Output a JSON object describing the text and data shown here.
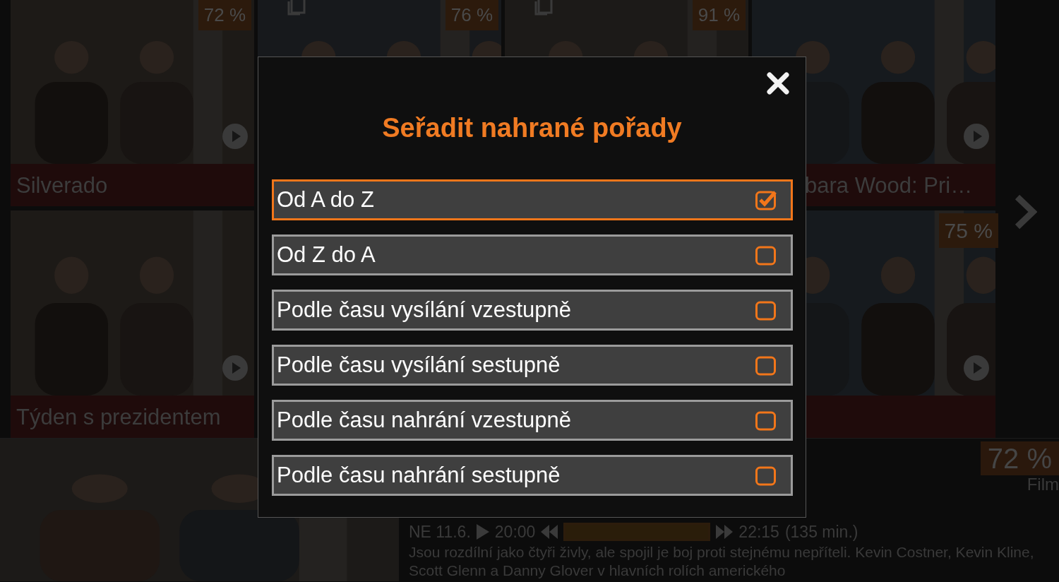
{
  "tiles": [
    {
      "kind": "tile",
      "badge": "72 %",
      "title": "Silverado"
    },
    {
      "kind": "partial",
      "badge": "76 %",
      "multi": true
    },
    {
      "kind": "partial",
      "badge": "91 %",
      "multi": true
    },
    {
      "kind": "tile",
      "title": "bara Wood: Pri…"
    },
    {
      "kind": "tile",
      "title": "Týden s prezidentem"
    },
    {
      "kind": "covered"
    },
    {
      "kind": "covered"
    },
    {
      "kind": "tile",
      "badge": "75 %"
    }
  ],
  "detail": {
    "badge": "72 %",
    "genre": "Film",
    "day": "NE 11.6.",
    "start": "20:00",
    "level": 1,
    "end": "22:15",
    "duration": "(135 min.)",
    "description": "Jsou rozdílní jako čtyři živly, ale spojil je boj proti stejnému nepříteli. Kevin Costner, Kevin Kline, Scott Glenn a Danny Glover v hlavních rolích amerického"
  },
  "dialog": {
    "title": "Seřadit nahrané pořady",
    "options": [
      {
        "label": "Od A do Z",
        "selected": true
      },
      {
        "label": "Od Z do A",
        "selected": false
      },
      {
        "label": "Podle času vysílání vzestupně",
        "selected": false
      },
      {
        "label": "Podle času vysílání sestupně",
        "selected": false
      },
      {
        "label": "Podle času nahrání vzestupně",
        "selected": false
      },
      {
        "label": "Podle času nahrání sestupně",
        "selected": false
      }
    ]
  }
}
